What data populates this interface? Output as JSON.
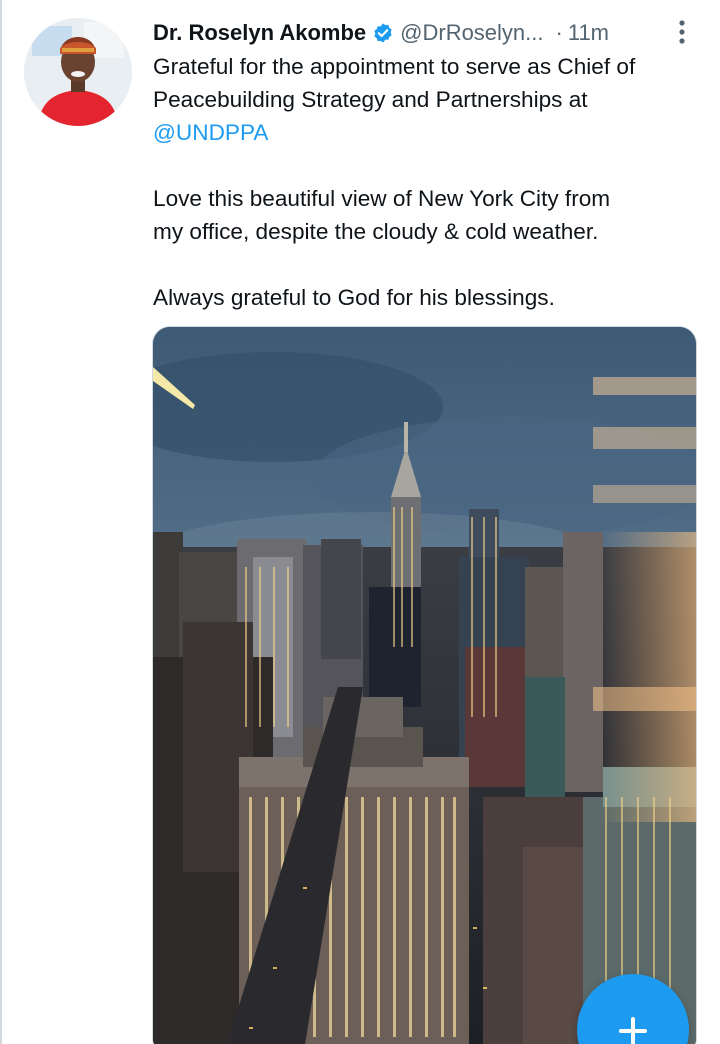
{
  "tweet": {
    "author_name": "Dr. Roselyn Akombe",
    "handle": "@DrRoselyn...",
    "separator": "·",
    "timestamp": "11m",
    "verified": true,
    "lines": [
      "Grateful for the appointment to serve as Chief of",
      "Peacebuilding Strategy and Partnerships at"
    ],
    "mention": "@UNDPPA",
    "paragraph_2": [
      "Love this beautiful view of New York City from",
      "my office, despite the cloudy & cold weather."
    ],
    "paragraph_3": "Always grateful to God for his blessings."
  },
  "icons": {
    "verified": "verified-badge-icon",
    "more": "more-vertical-icon",
    "compose": "plus-icon"
  },
  "colors": {
    "accent": "#1d9bf0",
    "text_primary": "#0f1419",
    "text_secondary": "#536471",
    "border": "#cfd9de"
  }
}
